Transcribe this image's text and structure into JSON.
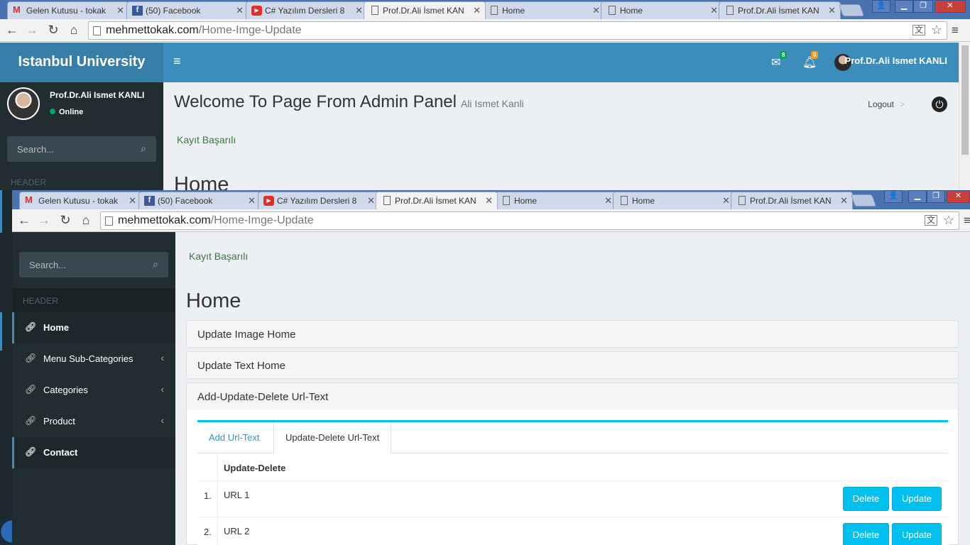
{
  "browser": {
    "tabs": [
      {
        "label": "Gelen Kutusu - tokak",
        "icon": "gmail-icon"
      },
      {
        "label": "(50) Facebook",
        "icon": "facebook-icon"
      },
      {
        "label": "C# Yazılım Dersleri 8",
        "icon": "youtube-icon"
      },
      {
        "label": "Prof.Dr.Ali İsmet KAN",
        "icon": "page-icon",
        "active": true
      },
      {
        "label": "Home",
        "icon": "page-icon"
      },
      {
        "label": "Home",
        "icon": "page-icon"
      },
      {
        "label": "Prof.Dr.Ali İsmet KAN",
        "icon": "page-icon"
      }
    ],
    "url_domain": "mehmettokak.com",
    "url_path": "/Home-Imge-Update",
    "colors": {
      "tabstrip": "#4a72b0",
      "close": "#c7413a"
    }
  },
  "back_window": {
    "brand": "Istanbul University",
    "header": {
      "mail_badge": "8",
      "notif_badge": "0",
      "user": "Prof.Dr.Ali Ismet KANLI"
    },
    "sidebar": {
      "user_name": "Prof.Dr.Ali Ismet KANLI",
      "status": "Online",
      "search_placeholder": "Search...",
      "header_label": "HEADER"
    },
    "content": {
      "title": "Welcome To Page From Admin Panel",
      "subtitle": "Ali Ismet Kanli",
      "logout": "Logout",
      "logout_sep": ">",
      "message": "Kayıt Başarılı",
      "heading": "Home"
    }
  },
  "front_window": {
    "sidebar": {
      "search_placeholder": "Search...",
      "header_label": "HEADER",
      "items": [
        {
          "label": "Home",
          "active": true,
          "has_children": false
        },
        {
          "label": "Menu Sub-Categories",
          "active": false,
          "has_children": true
        },
        {
          "label": "Categories",
          "active": false,
          "has_children": true
        },
        {
          "label": "Product",
          "active": false,
          "has_children": true
        },
        {
          "label": "Contact",
          "active": true,
          "has_children": false
        }
      ]
    },
    "content": {
      "message": "Kayıt Başarılı",
      "heading": "Home",
      "panels": [
        "Update Image Home",
        "Update Text Home",
        "Add-Update-Delete Url-Text"
      ],
      "tabs": [
        "Add Url-Text",
        "Update-Delete Url-Text"
      ],
      "table": {
        "header": "Update-Delete",
        "rows": [
          {
            "num": "1.",
            "url": "URL 1"
          },
          {
            "num": "2.",
            "url": "URL 2"
          }
        ],
        "delete_label": "Delete",
        "update_label": "Update"
      }
    },
    "colors": {
      "accent": "#00c0ef",
      "sidebar": "#222d32",
      "header": "#3c8dbc",
      "success": "#3c763d"
    }
  }
}
